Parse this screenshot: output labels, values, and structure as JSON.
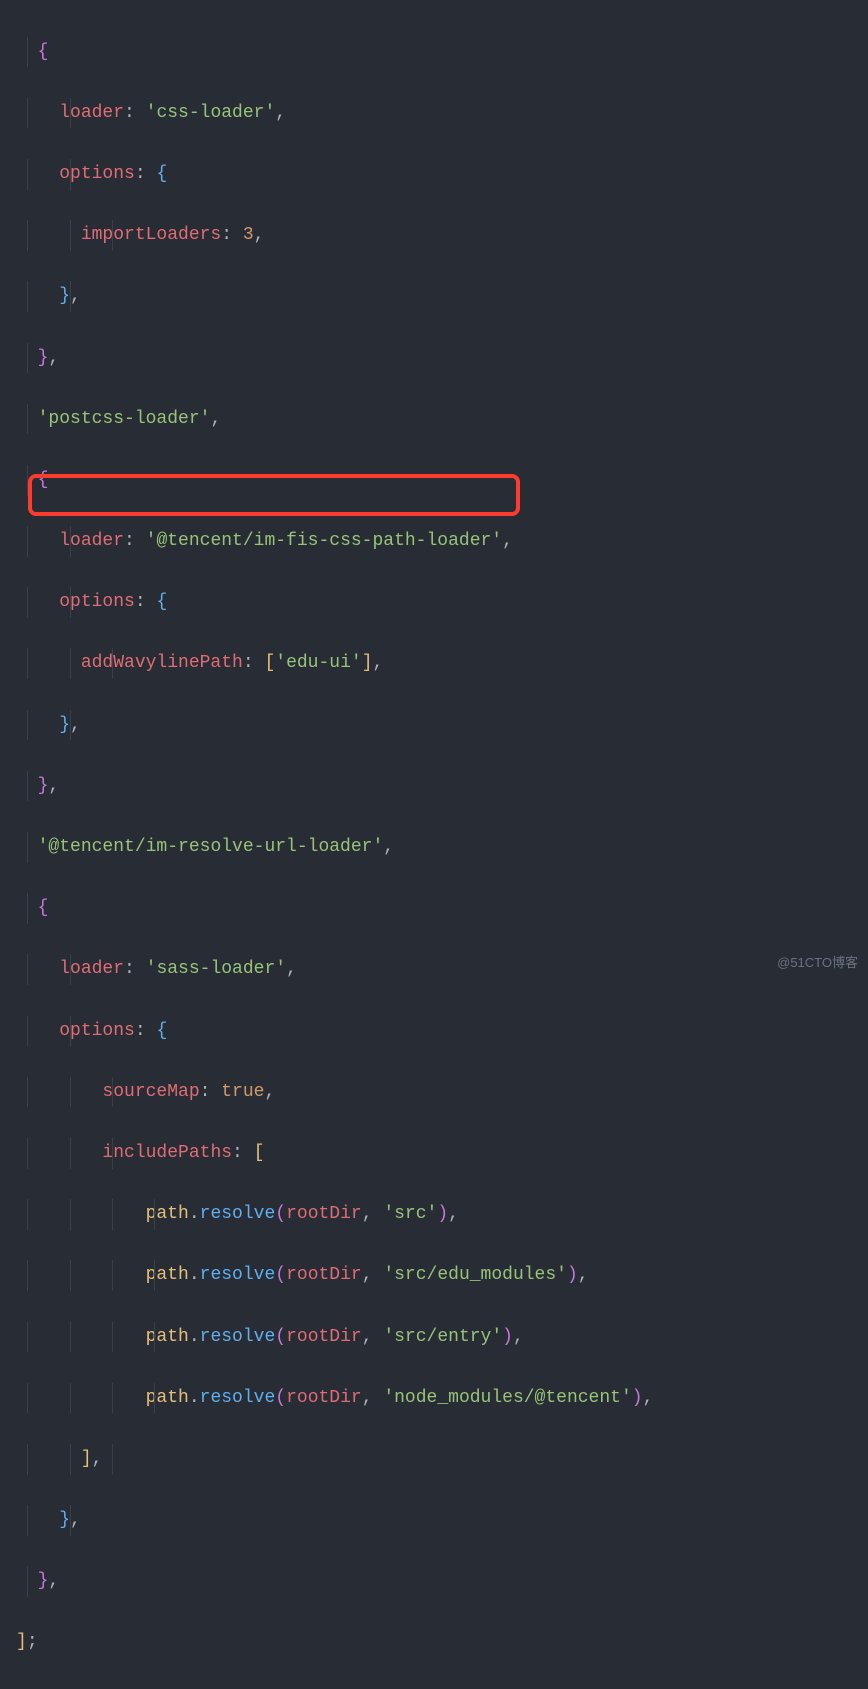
{
  "code": {
    "l1": {
      "open": "{"
    },
    "l2": {
      "key": "loader",
      "colon": ": ",
      "str": "'css-loader'",
      "comma": ","
    },
    "l3": {
      "key": "options",
      "colon": ": ",
      "open": "{"
    },
    "l4": {
      "key": "importLoaders",
      "colon": ": ",
      "num": "3",
      "comma": ","
    },
    "l5": {
      "close": "}",
      "comma": ","
    },
    "l6": {
      "close": "}",
      "comma": ","
    },
    "l7": {
      "str": "'postcss-loader'",
      "comma": ","
    },
    "l8": {
      "open": "{"
    },
    "l9": {
      "key": "loader",
      "colon": ": ",
      "str": "'@tencent/im-fis-css-path-loader'",
      "comma": ","
    },
    "l10": {
      "key": "options",
      "colon": ": ",
      "open": "{"
    },
    "l11": {
      "key": "addWavylinePath",
      "colon": ": ",
      "lbrack": "[",
      "str": "'edu-ui'",
      "rbrack": "]",
      "comma": ","
    },
    "l12": {
      "close": "}",
      "comma": ","
    },
    "l13": {
      "close": "}",
      "comma": ","
    },
    "l14": {
      "str": "'@tencent/im-resolve-url-loader'",
      "comma": ","
    },
    "l15": {
      "open": "{"
    },
    "l16": {
      "key": "loader",
      "colon": ": ",
      "str": "'sass-loader'",
      "comma": ","
    },
    "l17": {
      "key": "options",
      "colon": ": ",
      "open": "{"
    },
    "l18": {
      "key": "sourceMap",
      "colon": ": ",
      "bool": "true",
      "comma": ","
    },
    "l19": {
      "key": "includePaths",
      "colon": ": ",
      "lbrack": "["
    },
    "l20": {
      "var": "path",
      "dot": ".",
      "fn": "resolve",
      "lpar": "(",
      "arg1": "rootDir",
      "comma1": ", ",
      "str": "'src'",
      "rpar": ")",
      "comma": ","
    },
    "l21": {
      "var": "path",
      "dot": ".",
      "fn": "resolve",
      "lpar": "(",
      "arg1": "rootDir",
      "comma1": ", ",
      "str": "'src/edu_modules'",
      "rpar": ")",
      "comma": ","
    },
    "l22": {
      "var": "path",
      "dot": ".",
      "fn": "resolve",
      "lpar": "(",
      "arg1": "rootDir",
      "comma1": ", ",
      "str": "'src/entry'",
      "rpar": ")",
      "comma": ","
    },
    "l23": {
      "var": "path",
      "dot": ".",
      "fn": "resolve",
      "lpar": "(",
      "arg1": "rootDir",
      "comma1": ", ",
      "str": "'node_modules/@tencent'",
      "rpar": ")",
      "comma": ","
    },
    "l24": {
      "rbrack": "]",
      "comma": ","
    },
    "l25": {
      "close": "}",
      "comma": ","
    },
    "l26": {
      "close": "}",
      "comma": ","
    },
    "l27": {
      "rbrack": "]",
      "semi": ";"
    }
  },
  "watermark": "@51CTO博客"
}
